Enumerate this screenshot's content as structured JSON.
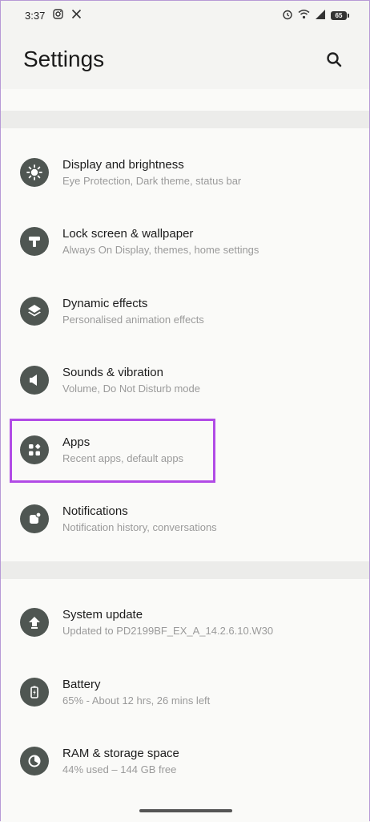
{
  "status_bar": {
    "time": "3:37",
    "battery": "65"
  },
  "header": {
    "title": "Settings"
  },
  "items": [
    {
      "title": "Display and brightness",
      "subtitle": "Eye Protection, Dark theme, status bar",
      "icon": "brightness-icon"
    },
    {
      "title": "Lock screen & wallpaper",
      "subtitle": "Always On Display, themes, home settings",
      "icon": "wallpaper-icon"
    },
    {
      "title": "Dynamic effects",
      "subtitle": "Personalised animation effects",
      "icon": "layers-icon"
    },
    {
      "title": "Sounds & vibration",
      "subtitle": "Volume, Do Not Disturb mode",
      "icon": "speaker-icon"
    },
    {
      "title": "Apps",
      "subtitle": "Recent apps, default apps",
      "icon": "apps-icon"
    },
    {
      "title": "Notifications",
      "subtitle": "Notification history, conversations",
      "icon": "notification-icon"
    },
    {
      "title": "System update",
      "subtitle": "Updated to PD2199BF_EX_A_14.2.6.10.W30",
      "icon": "update-icon"
    },
    {
      "title": "Battery",
      "subtitle": "65% - About 12 hrs, 26 mins left",
      "icon": "battery-icon"
    },
    {
      "title": "RAM & storage space",
      "subtitle": "44% used – 144 GB free",
      "icon": "storage-icon"
    }
  ],
  "colors": {
    "highlight": "#b14be6",
    "icon_bg": "#4f5652"
  }
}
